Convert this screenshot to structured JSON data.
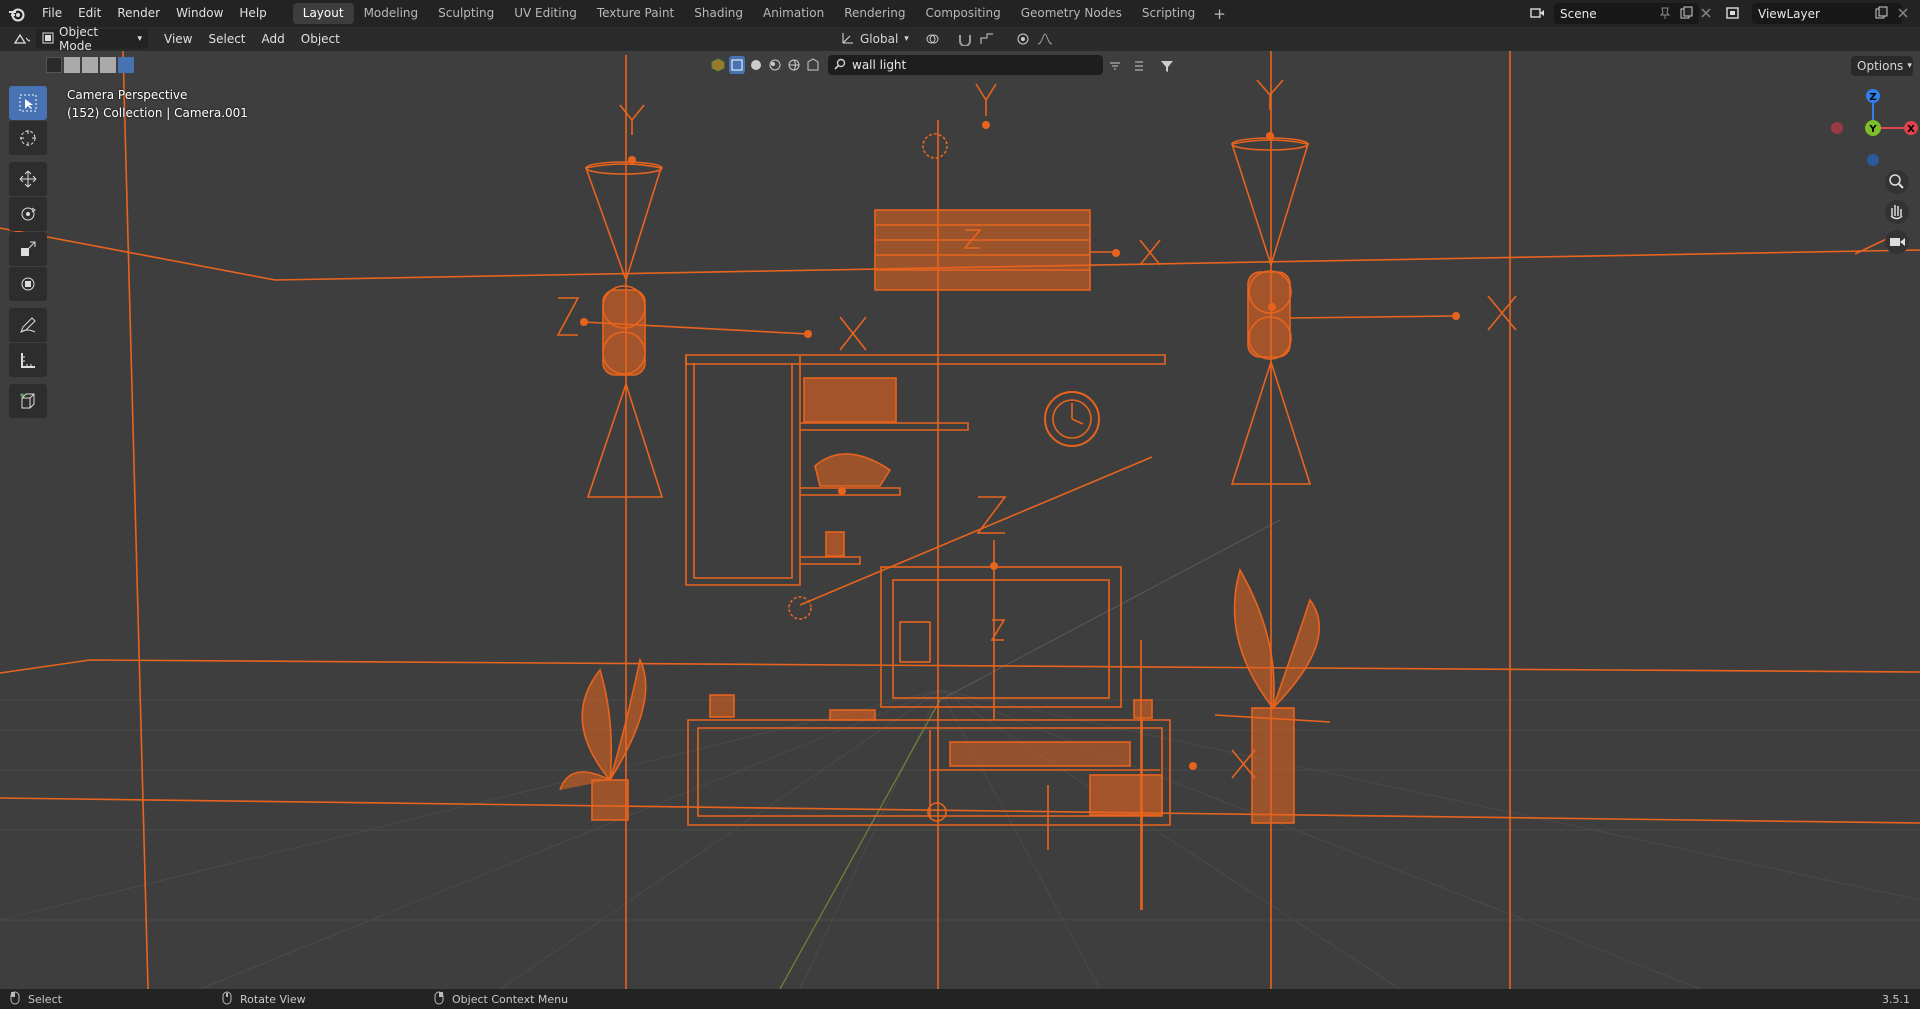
{
  "menu": {
    "items": [
      "File",
      "Edit",
      "Render",
      "Window",
      "Help"
    ]
  },
  "workspaces": {
    "tabs": [
      "Layout",
      "Modeling",
      "Sculpting",
      "UV Editing",
      "Texture Paint",
      "Shading",
      "Animation",
      "Rendering",
      "Compositing",
      "Geometry Nodes",
      "Scripting"
    ],
    "active": "Layout"
  },
  "scene": {
    "name": "Scene"
  },
  "view_layer": {
    "name": "ViewLayer"
  },
  "viewport_header": {
    "mode": "Object Mode",
    "menus": [
      "View",
      "Select",
      "Add",
      "Object"
    ],
    "orientation": "Global"
  },
  "search": {
    "value": "wall light",
    "placeholder": ""
  },
  "options_label": "Options",
  "overlay": {
    "view_name": "Camera Perspective",
    "collection_info": "(152) Collection | Camera.001"
  },
  "status_bar": {
    "select": "Select",
    "rotate": "Rotate View",
    "context": "Object Context Menu",
    "version": "3.5.1"
  },
  "colors": {
    "accent": "#4772b3",
    "selection_orange": "#e8641e",
    "viewport_bg": "#3e3e3e",
    "axis_x": "#e0424e",
    "axis_y": "#7ebd2a",
    "axis_z": "#2f80e8"
  },
  "gizmo": {
    "x_label": "X",
    "y_label": "Y",
    "z_label": "Z"
  }
}
